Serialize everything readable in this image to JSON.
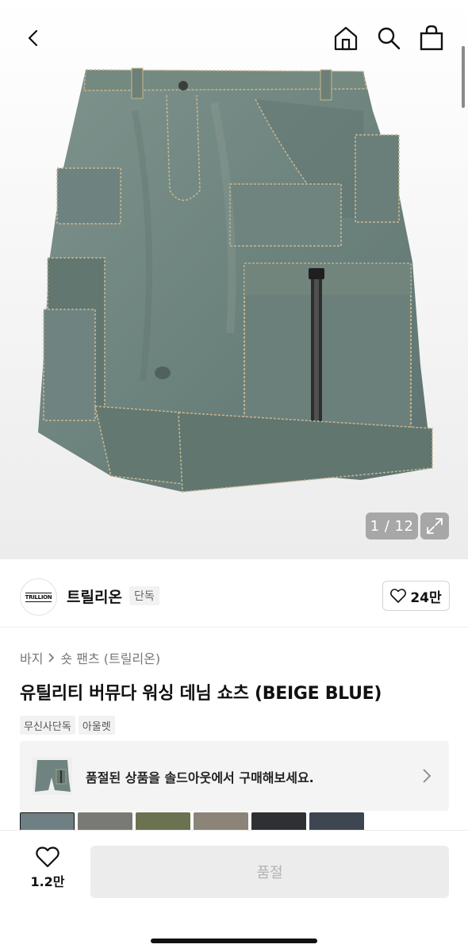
{
  "header": {
    "icons": [
      "chevron-left-icon",
      "home-icon",
      "search-icon",
      "shopping-bag-icon"
    ]
  },
  "gallery": {
    "counter": "1 / 12"
  },
  "brand": {
    "logo_text": "TRILLION",
    "name": "트릴리온",
    "tag": "단독",
    "likes": "24만"
  },
  "product": {
    "breadcrumb": {
      "category": "바지",
      "subcategory": "숏 팬츠 (트릴리온)"
    },
    "title": "유틸리티 버뮤다 워싱 데님 쇼츠 (BEIGE BLUE)",
    "tags": [
      "무신사단독",
      "아울렛"
    ],
    "soldout_message": "품절된 상품을 솔드아웃에서 구매해보세요."
  },
  "thumbnails": [
    {
      "color": "#6e8084"
    },
    {
      "color": "#7a7a74"
    },
    {
      "color": "#6b7250"
    },
    {
      "color": "#8c8478"
    },
    {
      "color": "#2f3033"
    },
    {
      "color": "#3e4652"
    }
  ],
  "bottom_bar": {
    "wish_count": "1.2만",
    "buy_label": "품절"
  },
  "colors": {
    "denim": "#6f8580",
    "denim_dark": "#55675f",
    "stitch": "#c8b792",
    "disabled_button": "#ececec"
  }
}
